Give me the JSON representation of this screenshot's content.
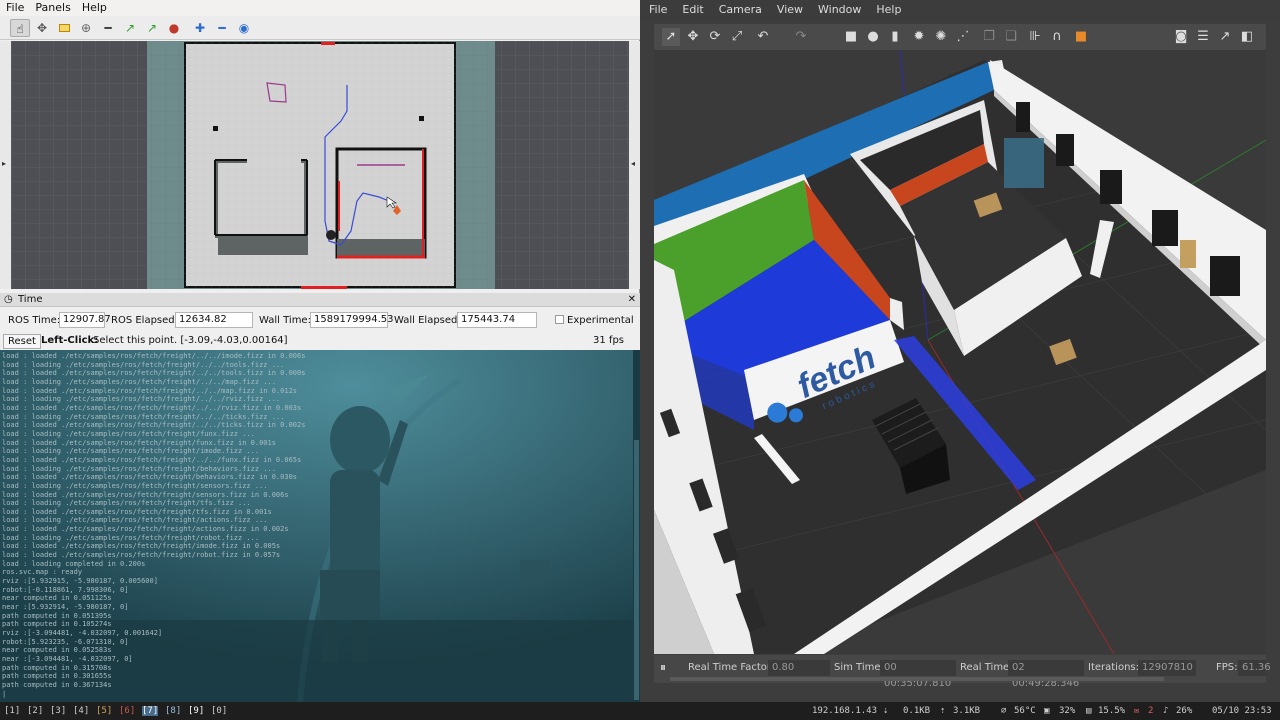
{
  "rviz": {
    "menu": [
      "File",
      "Panels",
      "Help"
    ],
    "toolbar_icons": [
      "interact-icon",
      "move-camera-icon",
      "select-icon",
      "focus-camera-icon",
      "measure-icon",
      "2d-pose-estimate-icon",
      "2d-nav-goal-icon",
      "publish-point-icon",
      "plus-icon",
      "minus-icon",
      "eye-icon"
    ],
    "time_panel": {
      "title": "Time",
      "ros_time_label": "ROS Time:",
      "ros_time": "12907.87",
      "ros_elapsed_label": "ROS Elapsed:",
      "ros_elapsed": "12634.82",
      "wall_time_label": "Wall Time:",
      "wall_time": "1589179994.53",
      "wall_elapsed_label": "Wall Elapsed:",
      "wall_elapsed": "175443.74",
      "experimental_label": "Experimental"
    },
    "status": {
      "reset_label": "Reset",
      "hint_bold": "Left-Click:",
      "hint_text": "Select this point. [-3.09,-4.03,0.00164]",
      "fps": "31 fps"
    }
  },
  "terminal": {
    "lines": [
      "load : loaded ./etc/samples/ros/fetch/freight/../../imode.fizz in 0.006s",
      "load : loading ./etc/samples/ros/fetch/freight/../../tools.fizz ...",
      "load : loaded ./etc/samples/ros/fetch/freight/../../tools.fizz in 0.000s",
      "load : loading ./etc/samples/ros/fetch/freight/../../map.fizz ...",
      "load : loaded ./etc/samples/ros/fetch/freight/../../map.fizz in 0.012s",
      "load : loading ./etc/samples/ros/fetch/freight/../../rviz.fizz ...",
      "load : loaded ./etc/samples/ros/fetch/freight/../../rviz.fizz in 0.003s",
      "load : loading ./etc/samples/ros/fetch/freight/../../ticks.fizz ...",
      "load : loaded ./etc/samples/ros/fetch/freight/../../ticks.fizz in 0.002s",
      "load : loading ./etc/samples/ros/fetch/freight/funx.fizz ...",
      "load : loaded ./etc/samples/ros/fetch/freight/funx.fizz in 0.001s",
      "load : loading ./etc/samples/ros/fetch/freight/imode.fizz ...",
      "load : loaded ./etc/samples/ros/fetch/freight/../../funx.fizz in 0.065s",
      "load : loading ./etc/samples/ros/fetch/freight/behaviors.fizz ...",
      "load : loaded ./etc/samples/ros/fetch/freight/behaviors.fizz in 0.030s",
      "load : loading ./etc/samples/ros/fetch/freight/sensors.fizz ...",
      "load : loaded ./etc/samples/ros/fetch/freight/sensors.fizz in 0.006s",
      "load : loading ./etc/samples/ros/fetch/freight/tfs.fizz ...",
      "load : loaded ./etc/samples/ros/fetch/freight/tfs.fizz in 0.001s",
      "load : loading ./etc/samples/ros/fetch/freight/actions.fizz ...",
      "load : loaded ./etc/samples/ros/fetch/freight/actions.fizz in 0.002s",
      "load : loading ./etc/samples/ros/fetch/freight/robot.fizz ...",
      "load : loaded ./etc/samples/ros/fetch/freight/imode.fizz in 0.005s",
      "load : loaded ./etc/samples/ros/fetch/freight/robot.fizz in 0.057s",
      "load : loading completed in 0.200s",
      "ros.svc.map : ready",
      "rviz :[5.932915, -5.980187, 0.005600]",
      "robot:[-0.118861, 7.998306, 0]",
      "near computed in 0.051125s",
      "near :[5.932914, -5.980187, 0]",
      "path computed in 0.051395s",
      "path computed in 0.105274s",
      "rviz :[-3.094481, -4.032097, 0.001642]",
      "robot:[5.923235, -6.071310, 0]",
      "near computed in 0.052583s",
      "near :[-3.094481, -4.032097, 0]",
      "path computed in 0.315708s",
      "path computed in 0.301655s",
      "path computed in 0.367134s",
      "|"
    ]
  },
  "gazebo": {
    "menu": [
      "File",
      "Edit",
      "Camera",
      "View",
      "Window",
      "Help"
    ],
    "toolbar_icons": [
      "arrow-select-icon",
      "translate-icon",
      "rotate-icon",
      "scale-icon",
      "undo-icon",
      "redo-icon",
      "box-icon",
      "sphere-icon",
      "cylinder-icon",
      "sun-light-icon",
      "point-light-icon",
      "spot-light-icon",
      "copy-icon",
      "paste-icon",
      "align-icon",
      "snap-icon",
      "select-color-icon",
      "screenshot-icon",
      "log-icon",
      "plot-icon",
      "video-icon"
    ],
    "logo_text": "fetch",
    "logo_sub": "robotics",
    "status": {
      "real_time_factor_label": "Real Time Factor:",
      "real_time_factor": "0.80",
      "sim_time_label": "Sim Time:",
      "sim_time": "00 00:35:07.810",
      "real_time_label": "Real Time:",
      "real_time": "02 00:49:28.346",
      "iterations_label": "Iterations:",
      "iterations": "12907810",
      "fps_label": "FPS:",
      "fps": "61.36"
    }
  },
  "taskbar": {
    "workspaces": [
      "[1]",
      "[2]",
      "[3]",
      "[4]",
      "[5]",
      "[6]",
      "[7]",
      "[8]",
      "[9]",
      "[0]"
    ],
    "ip": "192.168.1.43",
    "net_down": "0.1KB",
    "net_up": "3.1KB",
    "temp": "56°C",
    "cpu": "32%",
    "mem": "15.5%",
    "mem_count": "2",
    "vol": "26%",
    "datetime": "05/10 23:53"
  },
  "colors": {
    "rviz_grid_bg": "#4d4f55",
    "map_floor": "#d2d2d2",
    "wall_blue": "#1e6eb4",
    "floor_green": "#4aa02a",
    "wall_red": "#c8461e",
    "terminal_bg": "#1f4652"
  }
}
